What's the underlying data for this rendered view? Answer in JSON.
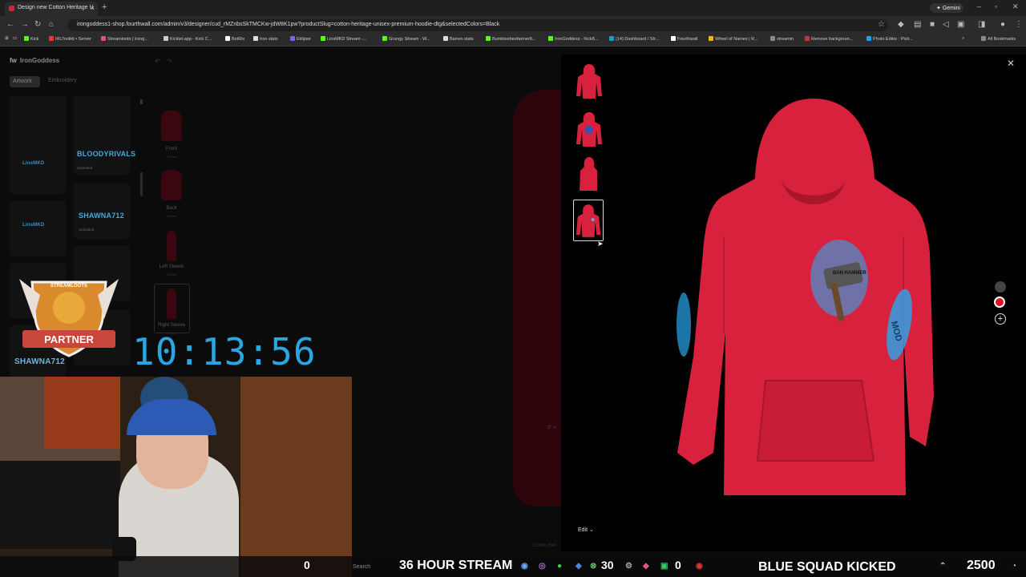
{
  "browser": {
    "tab_title": "Design new Cotton Heritage U",
    "url": "irongoddess1-shop.fourthwall.com/admin/v3/designer/cud_rMZnbsSkTMCKw-jdW8K1pw?productSlug=cotton-heritage-unisex-premium-hoodie-dtg&selectedColors=Black",
    "gemini_label": "Gemini",
    "bookmarks": [
      "Kick",
      "IRLToolkit • Server",
      "Streamloots | Irong...",
      "Kicklet.app - Kick C...",
      "BotRix",
      "Iron stats",
      "Eklipse",
      "LinsMKD Stream -...",
      "Grungy Stream - W...",
      "Barren stats",
      "Bumbleebeefarmer8...",
      "IronGoddess - Kick8...",
      "(14) Dashboard / Str...",
      "Fourthwall",
      "Wheel of Names | R...",
      "streamin",
      "Remove backgroun...",
      "Photo Editor : Pixlr..."
    ],
    "all_bookmarks": "All Bookmarks"
  },
  "designer": {
    "brand": "IronGoddess",
    "tabs": [
      "Artwork",
      "Embroidery"
    ],
    "artwork_labels": [
      "BLOODYRIVALS",
      "SHAWNA712",
      "SHAWNA712"
    ],
    "artwork_small_labels": [
      "LinsMKD",
      "LinsMKD"
    ],
    "uploaded": "Uploaded",
    "views": [
      {
        "label": "Front",
        "sub": "Printed"
      },
      {
        "label": "Back",
        "sub": "Printed"
      },
      {
        "label": "Left Sleeve",
        "sub": "Printed"
      },
      {
        "label": "Right Sleeve",
        "sub": "Printed"
      }
    ],
    "measurement": "3\" x",
    "footer_brand": "Cotton Heri"
  },
  "preview": {
    "edit_label": "Edit",
    "hammer_text": "BAN HAMMER",
    "sleeve_text": "MOD",
    "colors": {
      "hoodie": "#d8213d",
      "selected": "#e0102c",
      "gray": "#444444"
    }
  },
  "overlay": {
    "badge_top": "STREAMLOOTS",
    "badge_bottom": "PARTNER",
    "timer": "10:13:56",
    "counter_left": "0",
    "search": "Search",
    "stream_title": "36 HOUR STREAM",
    "count_30": "30",
    "count_0": "0",
    "blue_squad": "BLUE SQUAD KICKED",
    "bits": "2500"
  }
}
